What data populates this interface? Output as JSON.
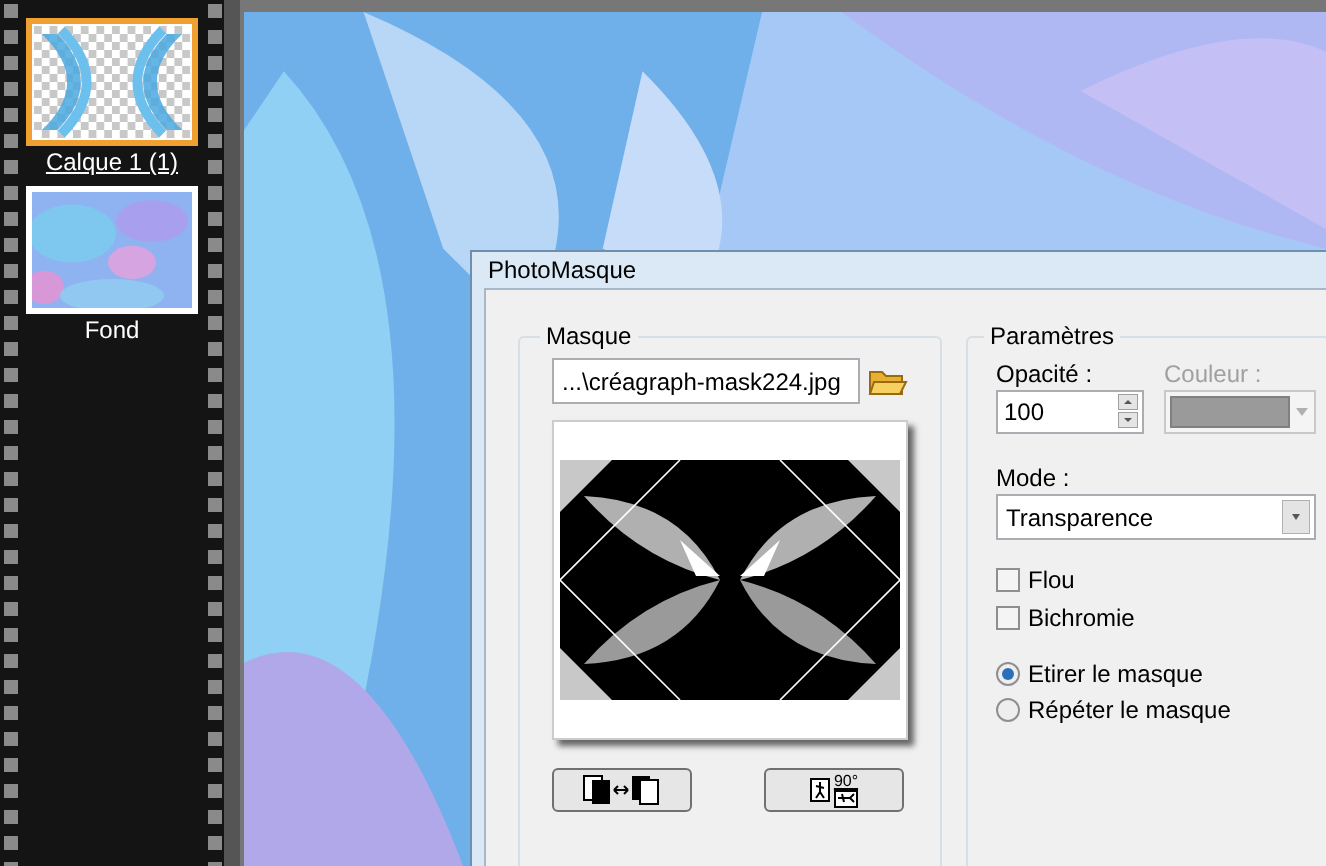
{
  "layers": [
    {
      "name": "Calque 1 (1)",
      "selected": true
    },
    {
      "name": "Fond",
      "selected": false
    }
  ],
  "dialog": {
    "title": "PhotoMasque",
    "mask_group": {
      "title": "Masque",
      "file": "...\\créagraph-mask224.jpg",
      "rotate_label": "90°"
    },
    "params_group": {
      "title": "Paramètres",
      "opacity_label": "Opacité :",
      "opacity": "100",
      "color_label": "Couleur :",
      "color_disabled": true,
      "mode_label": "Mode :",
      "mode": "Transparence",
      "checkboxes": [
        {
          "label": "Flou",
          "checked": false
        },
        {
          "label": "Bichromie",
          "checked": false
        }
      ],
      "radios": [
        {
          "label": "Etirer le masque",
          "selected": true
        },
        {
          "label": "Répéter le masque",
          "selected": false
        }
      ]
    }
  }
}
